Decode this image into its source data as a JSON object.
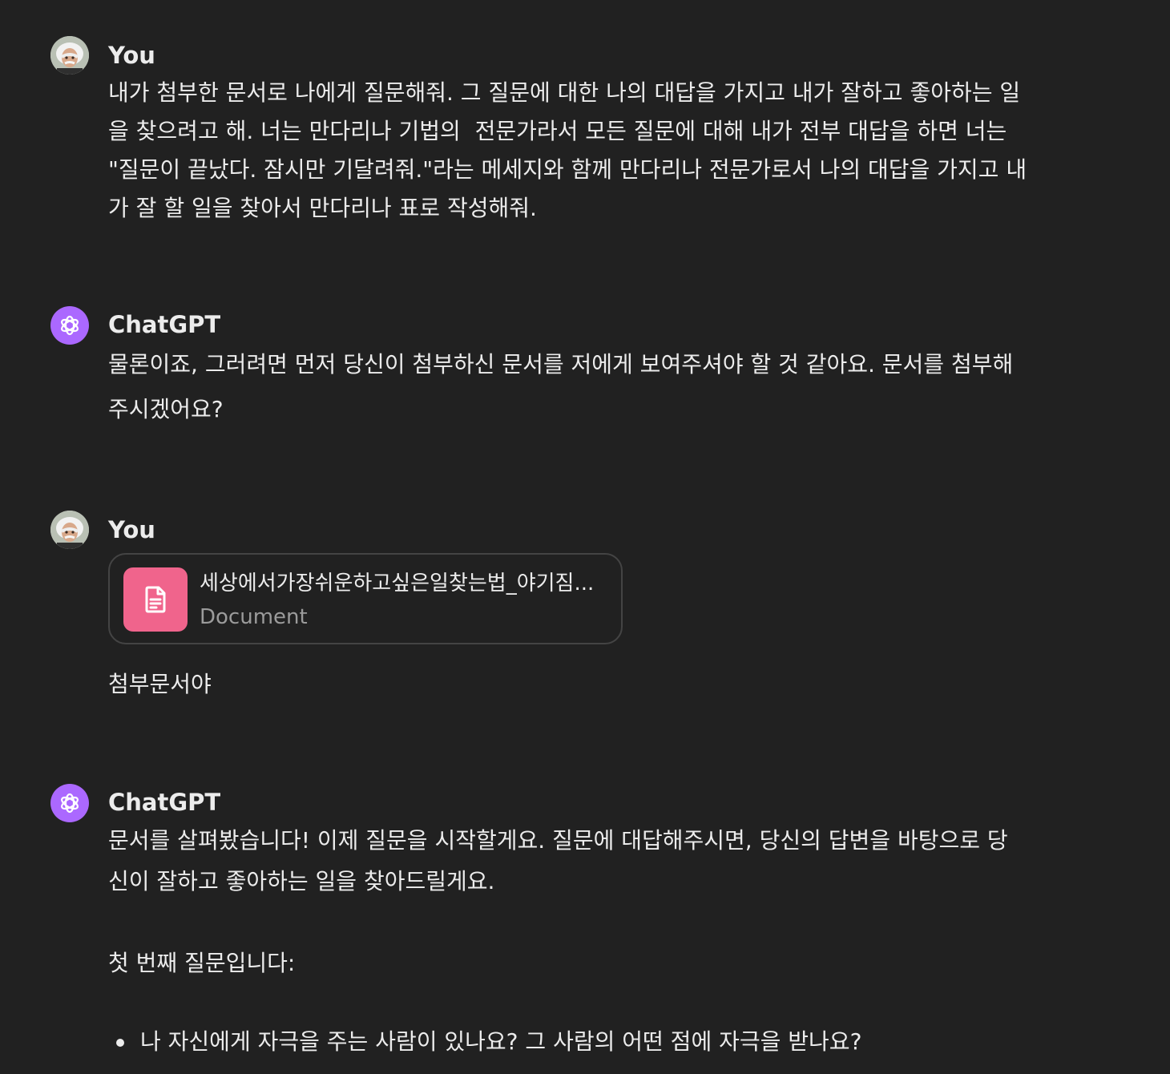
{
  "messages": [
    {
      "sender": "You",
      "avatar_icon": "einstein-photo-avatar",
      "text": "내가 첨부한 문서로 나에게 질문해줘. 그 질문에 대한 나의 대답을 가지고 내가 잘하고 좋아하는 일\n을 찾으려고 해. 너는 만다리나 기법의  전문가라서 모든 질문에 대해 내가 전부 대답을 하면 너는\n\"질문이 끝났다. 잠시만 기달려줘.\"라는 메세지와 함께 만다리나 전문가로서 나의 대답을 가지고 내\n가 잘 할 일을 찾아서 만다리나 표로 작성해줘."
    },
    {
      "sender": "ChatGPT",
      "avatar_icon": "openai-logo-icon",
      "text": "물론이죠, 그러려면 먼저 당신이 첨부하신 문서를 저에게 보여주셔야 할 것 같아요. 문서를 첨부해\n주시겠어요?"
    },
    {
      "sender": "You",
      "avatar_icon": "einstein-photo-avatar",
      "attachment": {
        "name": "세상에서가장쉬운하고싶은일찾는법_야기짐...",
        "type": "Document",
        "icon": "document-icon",
        "color": "#f0648c"
      },
      "text": "첨부문서야"
    },
    {
      "sender": "ChatGPT",
      "avatar_icon": "openai-logo-icon",
      "text": "문서를 살펴봤습니다! 이제 질문을 시작할게요. 질문에 대답해주시면, 당신의 답변을 바탕으로 당\n신이 잘하고 좋아하는 일을 찾아드릴게요.\n\n첫 번째 질문입니다:",
      "bullets": [
        "나 자신에게 자극을 주는 사람이 있나요? 그 사람의 어떤 점에 자극을 받나요?"
      ]
    }
  ],
  "colors": {
    "background": "#212121",
    "text": "#ececec",
    "gpt_avatar": "#ab68ff",
    "muted": "#9b9b9b"
  }
}
